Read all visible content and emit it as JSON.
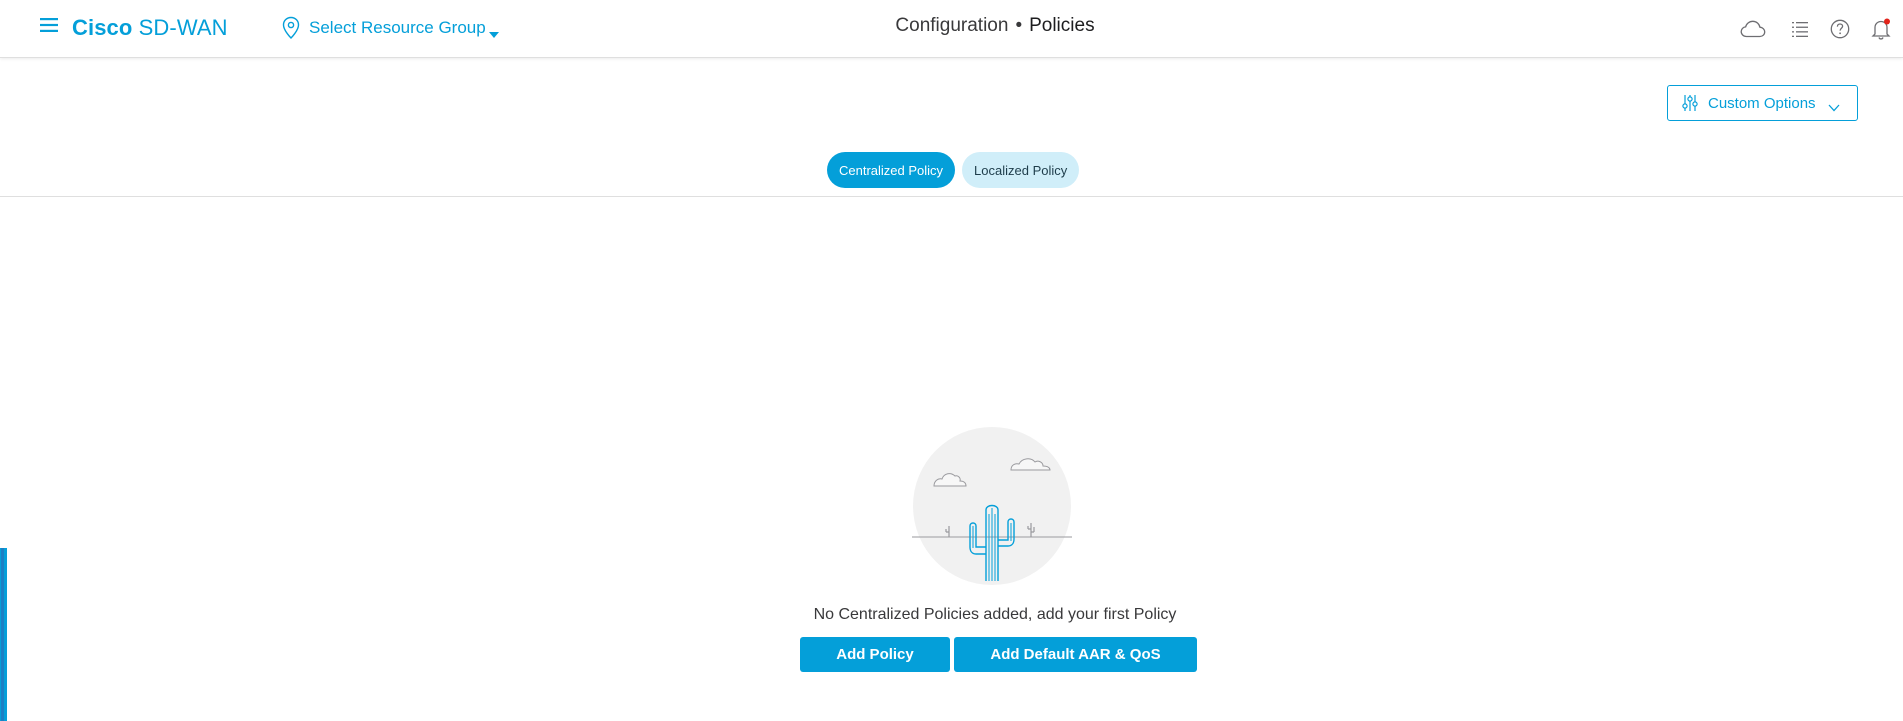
{
  "header": {
    "brand_bold": "Cisco",
    "brand_rest": "SD-WAN",
    "resource_group_label": "Select Resource Group",
    "breadcrumb_section": "Configuration",
    "breadcrumb_separator": "•",
    "breadcrumb_page": "Policies",
    "icons": [
      "menu-icon",
      "location-pin-icon",
      "cloud-icon",
      "list-icon",
      "help-icon",
      "bell-icon"
    ],
    "notification_dot_color": "#e2231a"
  },
  "toolbar": {
    "custom_options_label": "Custom Options"
  },
  "tabs": [
    {
      "label": "Centralized Policy",
      "active": true
    },
    {
      "label": "Localized Policy",
      "active": false
    }
  ],
  "empty_state": {
    "message": "No Centralized Policies added, add your first Policy",
    "illustration": "desert-cactus-illustration"
  },
  "actions": {
    "add_policy_label": "Add Policy",
    "add_default_label": "Add Default AAR & QoS"
  },
  "colors": {
    "accent": "#049fd9",
    "tab_inactive_bg": "#d0eef9",
    "text": "#39393b"
  }
}
